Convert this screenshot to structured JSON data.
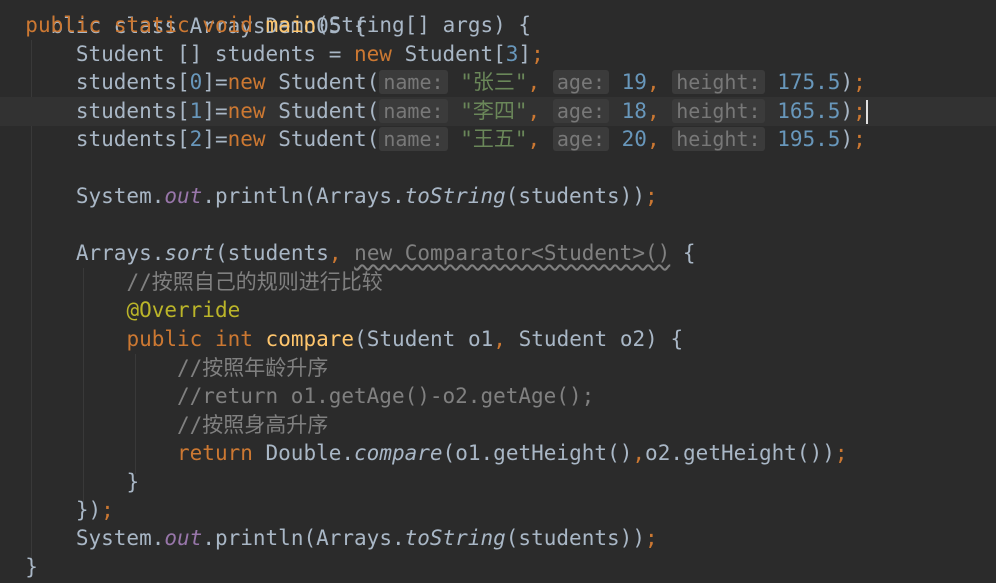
{
  "code": {
    "class_header": "blic class ArraysDemo05 {",
    "main_sig": {
      "public": "public",
      "static": "static",
      "void": "void",
      "name": "main",
      "params": "(String[] args) {"
    },
    "array_decl": {
      "type": "Student [] students = ",
      "new": "new",
      "ctor": " Student[",
      "size": "3",
      "end": "];"
    },
    "students": [
      {
        "prefix": "students[",
        "index": "0",
        "mid": "]=",
        "new": "new",
        "ctor": " Student(",
        "hint_name": "name:",
        "name": "\"张三\"",
        "hint_age": "age:",
        "age": "19",
        "hint_height": "height:",
        "height": "175.5",
        "end": ");"
      },
      {
        "prefix": "students[",
        "index": "1",
        "mid": "]=",
        "new": "new",
        "ctor": " Student(",
        "hint_name": "name:",
        "name": "\"李四\"",
        "hint_age": "age:",
        "age": "18",
        "hint_height": "height:",
        "height": "165.5",
        "end": ");"
      },
      {
        "prefix": "students[",
        "index": "2",
        "mid": "]=",
        "new": "new",
        "ctor": " Student(",
        "hint_name": "name:",
        "name": "\"王五\"",
        "hint_age": "age:",
        "age": "20",
        "hint_height": "height:",
        "height": "195.5",
        "end": ");"
      }
    ],
    "println1": {
      "system": "System.",
      "out": "out",
      "println": ".println(Arrays.",
      "tostring": "toString",
      "args": "(students));"
    },
    "sort_line": {
      "arrays": "Arrays.",
      "sort": "sort",
      "args": "(students, ",
      "anon": "new Comparator<Student>()",
      "end": " {"
    },
    "comment_rule": "//按照自己的规则进行比较",
    "override": "@Override",
    "compare_sig": {
      "public": "public",
      "int": "int",
      "name": "compare",
      "params": "(Student o1, Student o2) {"
    },
    "comment_age": "//按照年龄升序",
    "comment_return": "//return o1.getAge()-o2.getAge();",
    "comment_height": "//按照身高升序",
    "return_line": {
      "return": "return",
      "double": " Double.",
      "compare": "compare",
      "args": "(o1.getHeight(),o2.getHeight());"
    },
    "close_method": "}",
    "close_sort": "});",
    "println2": {
      "system": "System.",
      "out": "out",
      "println": ".println(Arrays.",
      "tostring": "toString",
      "args": "(students));"
    },
    "close_main": "}"
  }
}
